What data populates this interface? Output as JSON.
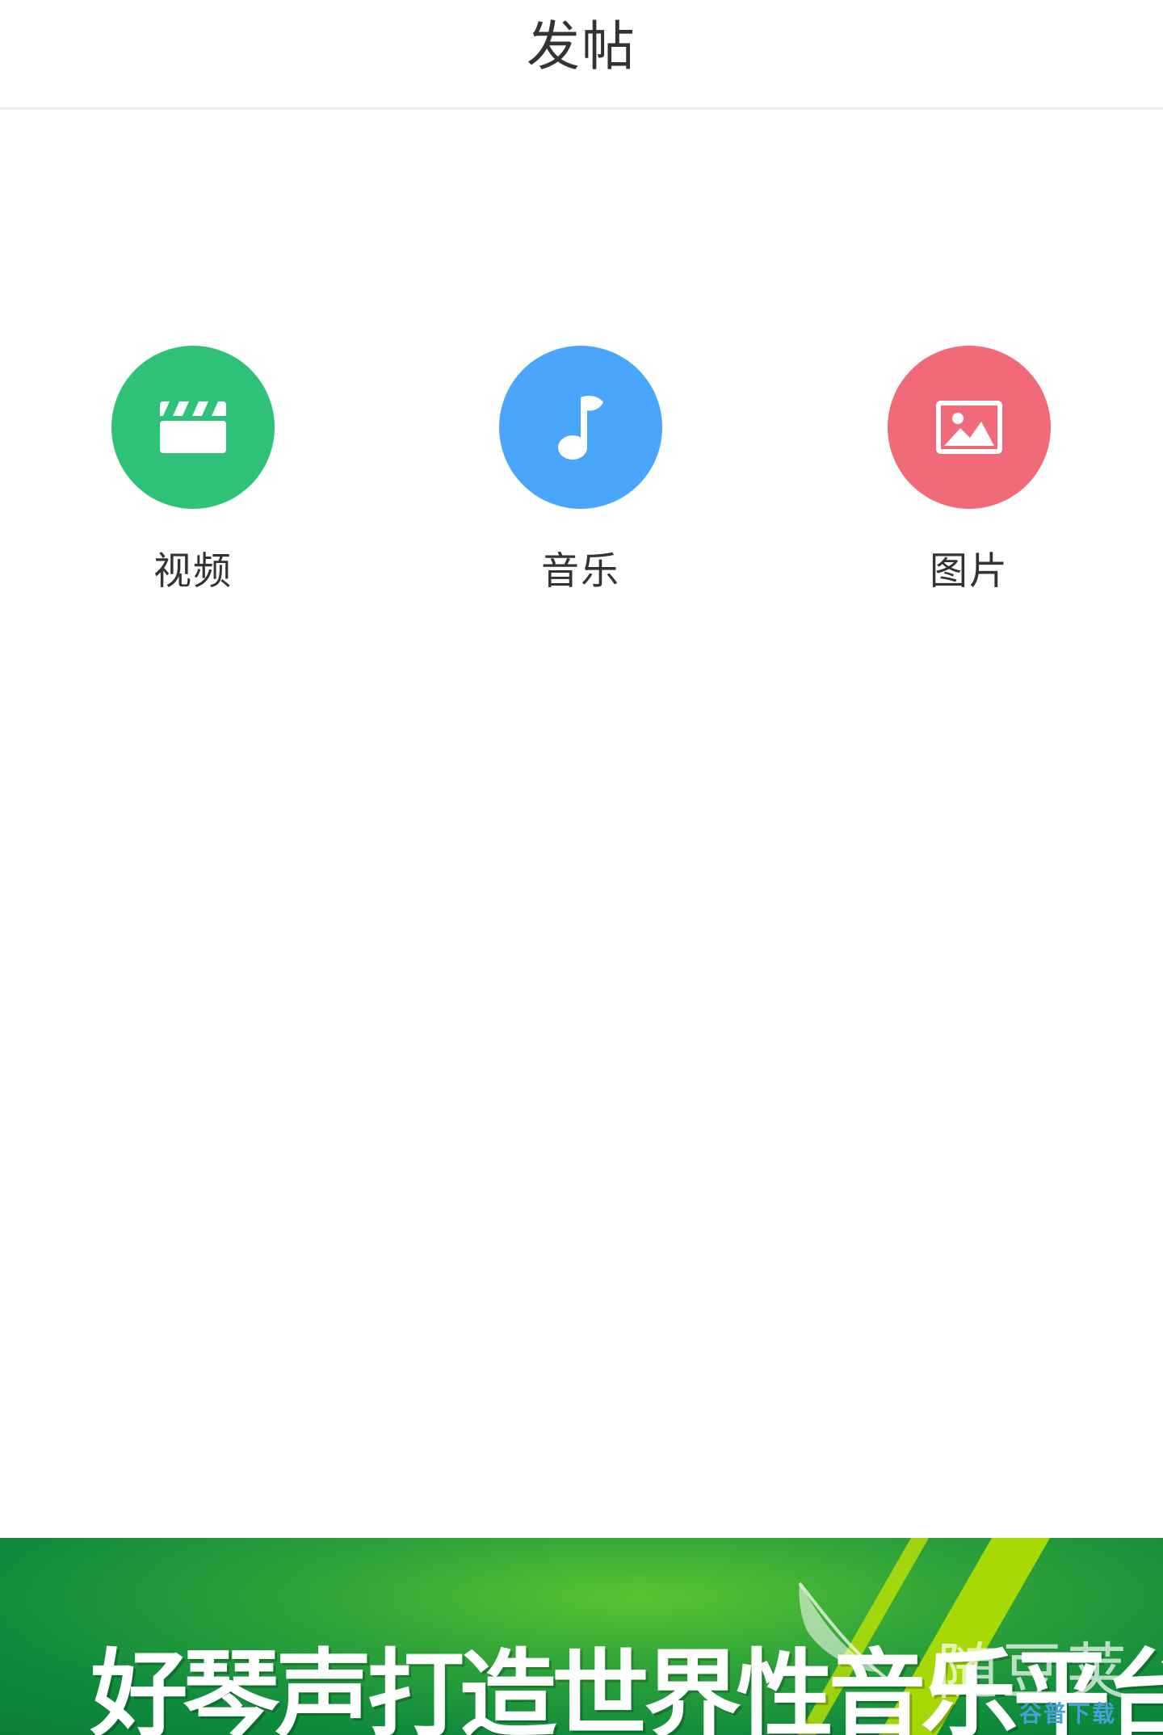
{
  "header": {
    "title": "发帖"
  },
  "options": [
    {
      "label": "视频",
      "icon": "clapperboard-icon",
      "color": "#2fc178"
    },
    {
      "label": "音乐",
      "icon": "music-note-icon",
      "color": "#4aa6fb"
    },
    {
      "label": "图片",
      "icon": "image-icon",
      "color": "#f06a79"
    }
  ],
  "banner": {
    "text": "好琴声打造世界性音乐平台",
    "color": "#1a9a3a",
    "accent_color": "#b5e000"
  },
  "watermark": {
    "text": "随豆荚",
    "sub": "谷普下载",
    "sub_color": "#4a9fd8"
  }
}
